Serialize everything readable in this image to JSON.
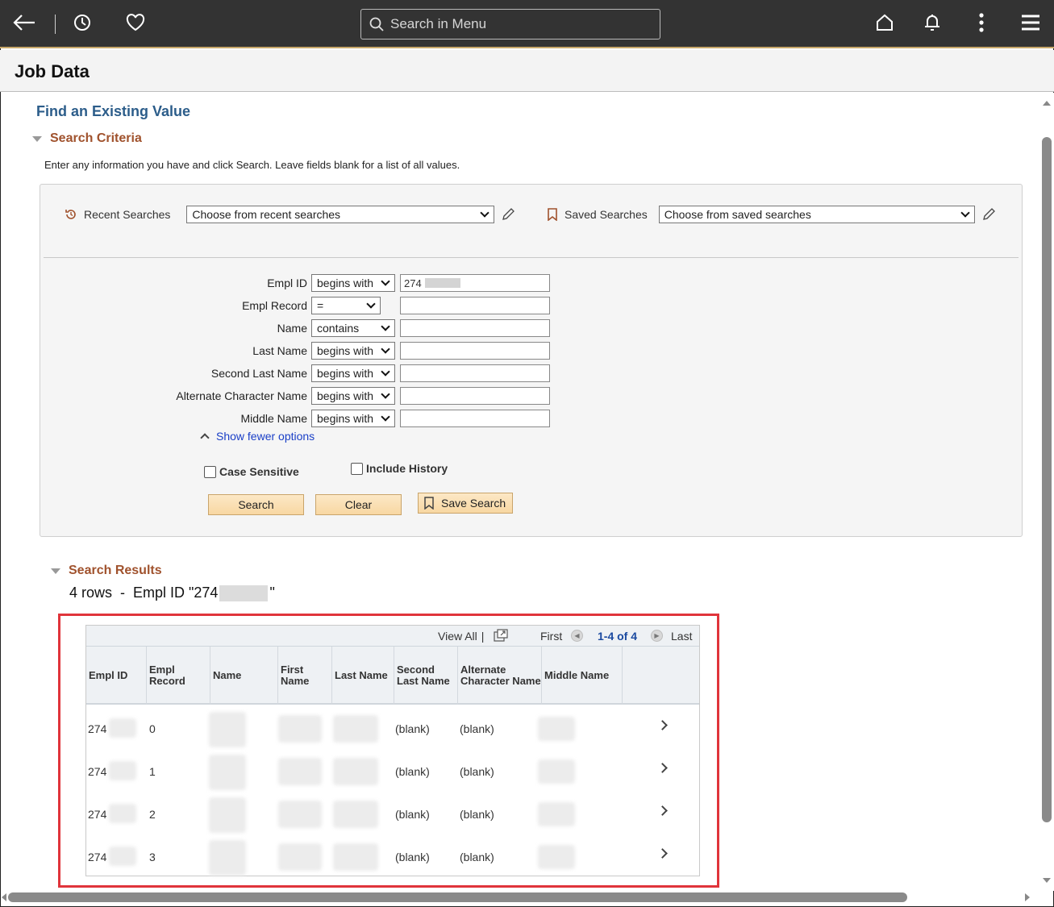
{
  "topbar": {
    "search_placeholder": "Search in Menu",
    "icons": [
      "back-arrow-icon",
      "history-clock-icon",
      "favorites-heart-icon",
      "home-icon",
      "notifications-bell-icon",
      "more-actions-icon",
      "navbar-menu-icon"
    ]
  },
  "page": {
    "title": "Job Data"
  },
  "find": {
    "title": "Find an Existing Value"
  },
  "criteria": {
    "section_label": "Search Criteria",
    "instructions": "Enter any information you have and click Search. Leave fields blank for a list of all values.",
    "recent_label": "Recent Searches",
    "recent_value": "Choose from recent searches",
    "saved_label": "Saved Searches",
    "saved_value": "Choose from saved searches",
    "fields": [
      {
        "label": "Empl ID",
        "operator": "begins with",
        "value": "274"
      },
      {
        "label": "Empl Record",
        "operator": "=",
        "value": ""
      },
      {
        "label": "Name",
        "operator": "contains",
        "value": ""
      },
      {
        "label": "Last Name",
        "operator": "begins with",
        "value": ""
      },
      {
        "label": "Second Last Name",
        "operator": "begins with",
        "value": ""
      },
      {
        "label": "Alternate Character Name",
        "operator": "begins with",
        "value": ""
      },
      {
        "label": "Middle Name",
        "operator": "begins with",
        "value": ""
      }
    ],
    "show_fewer": "Show fewer options",
    "case_sensitive": "Case Sensitive",
    "include_history": "Include History",
    "buttons": {
      "search": "Search",
      "clear": "Clear",
      "save_search": "Save Search"
    }
  },
  "results": {
    "section_label": "Search Results",
    "count_prefix": "4 rows  -  Empl ID \"274",
    "count_suffix": "\"",
    "nav": {
      "view_all": "View All",
      "sep": "|",
      "first": "First",
      "range": "1-4 of 4",
      "last": "Last"
    },
    "columns": [
      "Empl ID",
      "Empl Record",
      "Name",
      "First Name",
      "Last Name",
      "Second Last Name",
      "Alternate Character Name",
      "Middle Name"
    ],
    "rows": [
      {
        "empl_id": "274",
        "empl_record": "0",
        "second_last": "(blank)",
        "alt_char": "(blank)"
      },
      {
        "empl_id": "274",
        "empl_record": "1",
        "second_last": "(blank)",
        "alt_char": "(blank)"
      },
      {
        "empl_id": "274",
        "empl_record": "2",
        "second_last": "(blank)",
        "alt_char": "(blank)"
      },
      {
        "empl_id": "274",
        "empl_record": "3",
        "second_last": "(blank)",
        "alt_char": "(blank)"
      }
    ]
  }
}
